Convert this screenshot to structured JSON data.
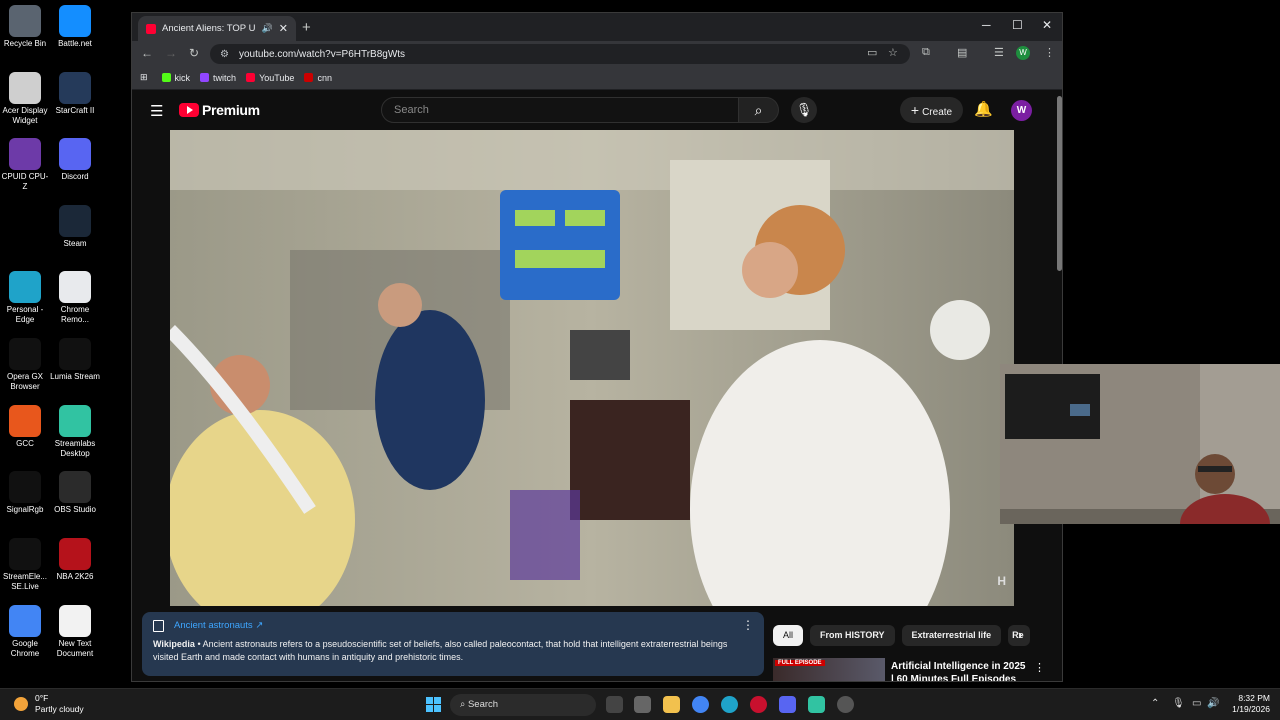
{
  "desktop": {
    "icons": [
      {
        "label": "Recycle Bin",
        "icon": "recycle-bin-icon",
        "color": "#5a6470"
      },
      {
        "label": "Battle.net",
        "icon": "battlenet-icon",
        "color": "#148eff"
      },
      {
        "label": "Acer Display Widget",
        "icon": "acer-display-icon",
        "color": "#cfcfcf"
      },
      {
        "label": "StarCraft II",
        "icon": "starcraft-icon",
        "color": "#253a5a"
      },
      {
        "label": "CPUID CPU-Z",
        "icon": "cpuz-icon",
        "color": "#6d3aa8"
      },
      {
        "label": "Discord",
        "icon": "discord-icon",
        "color": "#5865f2"
      },
      {
        "label": "Steam",
        "icon": "steam-icon",
        "color": "#1b2838"
      },
      {
        "label": "Personal - Edge",
        "icon": "edge-icon",
        "color": "#1fa3c9"
      },
      {
        "label": "Chrome Remo...",
        "icon": "chrome-remote-icon",
        "color": "#e8eaed"
      },
      {
        "label": "Opera GX Browser",
        "icon": "opera-gx-icon",
        "color": "#111"
      },
      {
        "label": "Lumia Stream",
        "icon": "lumia-icon",
        "color": "#111"
      },
      {
        "label": "GCC",
        "icon": "gcc-icon",
        "color": "#e8571c"
      },
      {
        "label": "Streamlabs Desktop",
        "icon": "streamlabs-icon",
        "color": "#31c3a2"
      },
      {
        "label": "SignalRgb",
        "icon": "signalrgb-icon",
        "color": "#111"
      },
      {
        "label": "OBS Studio",
        "icon": "obs-icon",
        "color": "#2b2b2b"
      },
      {
        "label": "StreamEle... SE.Live",
        "icon": "streamelements-icon",
        "color": "#111"
      },
      {
        "label": "NBA 2K26",
        "icon": "nba2k-icon",
        "color": "#b5121b"
      },
      {
        "label": "Google Chrome",
        "icon": "chrome-icon",
        "color": "#4285f4"
      },
      {
        "label": "New Text Document",
        "icon": "text-document-icon",
        "color": "#f2f2f2"
      }
    ]
  },
  "browser": {
    "tab_title": "Ancient Aliens: TOP UFO M",
    "new_tab": "+",
    "url": "youtube.com/watch?v=P6HTrB8gWts",
    "bookmarks": [
      {
        "label": "kick",
        "color": "#53fc18"
      },
      {
        "label": "twitch",
        "color": "#9146ff"
      },
      {
        "label": "YouTube",
        "color": "#ff0033"
      },
      {
        "label": "cnn",
        "color": "#cc0000"
      }
    ],
    "profile_initial": "W"
  },
  "youtube": {
    "brand": "Premium",
    "search_placeholder": "Search",
    "create_label": "Create",
    "avatar_initial": "W",
    "channel_watermark": "H",
    "info_panel": {
      "link": "Ancient astronauts ↗",
      "source": "Wikipedia",
      "text": " • Ancient astronauts refers to a pseudoscientific set of beliefs, also called paleocontact, that hold that intelligent extraterrestrial beings visited Earth and made contact with humans in antiquity and prehistoric times."
    },
    "chips": [
      "All",
      "From HISTORY",
      "Extraterrestrial life",
      "Re"
    ],
    "recommendation": {
      "badge": "FULL EPISODE",
      "title": "Artificial Intelligence in 2025 | 60 Minutes Full Episodes"
    }
  },
  "taskbar": {
    "weather_temp": "0°F",
    "weather_desc": "Partly cloudy",
    "search_label": "Search",
    "time": "8:32 PM",
    "date": "1/19/2026"
  }
}
